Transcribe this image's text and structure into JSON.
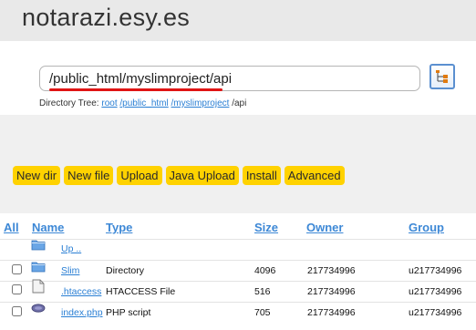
{
  "site": {
    "title": "notarazi.esy.es"
  },
  "path_input": {
    "value": "/public_html/myslimproject/api"
  },
  "tree_button": {
    "icon": "directory-tree-icon"
  },
  "directory_tree": {
    "label": "Directory Tree:",
    "crumbs": [
      "root",
      "/public_html",
      "/myslimproject"
    ],
    "current": "/api"
  },
  "toolbar": {
    "buttons": [
      "New dir",
      "New file",
      "Upload",
      "Java Upload",
      "Install",
      "Advanced"
    ],
    "accent": "#ffd200"
  },
  "columns": {
    "all": "All",
    "name": "Name",
    "type": "Type",
    "size": "Size",
    "owner": "Owner",
    "group": "Group"
  },
  "rows": [
    {
      "icon": "folder-icon",
      "name": "Up ..",
      "type": "",
      "size": "",
      "owner": "",
      "group": "",
      "checkbox": false
    },
    {
      "icon": "folder-icon",
      "name": "Slim",
      "type": "Directory",
      "size": "4096",
      "owner": "217734996",
      "group": "u217734996",
      "checkbox": true
    },
    {
      "icon": "file-icon",
      "name": ".htaccess",
      "type": "HTACCESS File",
      "size": "516",
      "owner": "217734996",
      "group": "u217734996",
      "checkbox": true
    },
    {
      "icon": "php-file-icon",
      "name": "index.php",
      "type": "PHP script",
      "size": "705",
      "owner": "217734996",
      "group": "u217734996",
      "checkbox": true
    }
  ],
  "colors": {
    "header_bg": "#e9e9e9",
    "link": "#2a7fd4",
    "heading_link": "#3d88d6",
    "highlight_underline": "#e01515"
  }
}
